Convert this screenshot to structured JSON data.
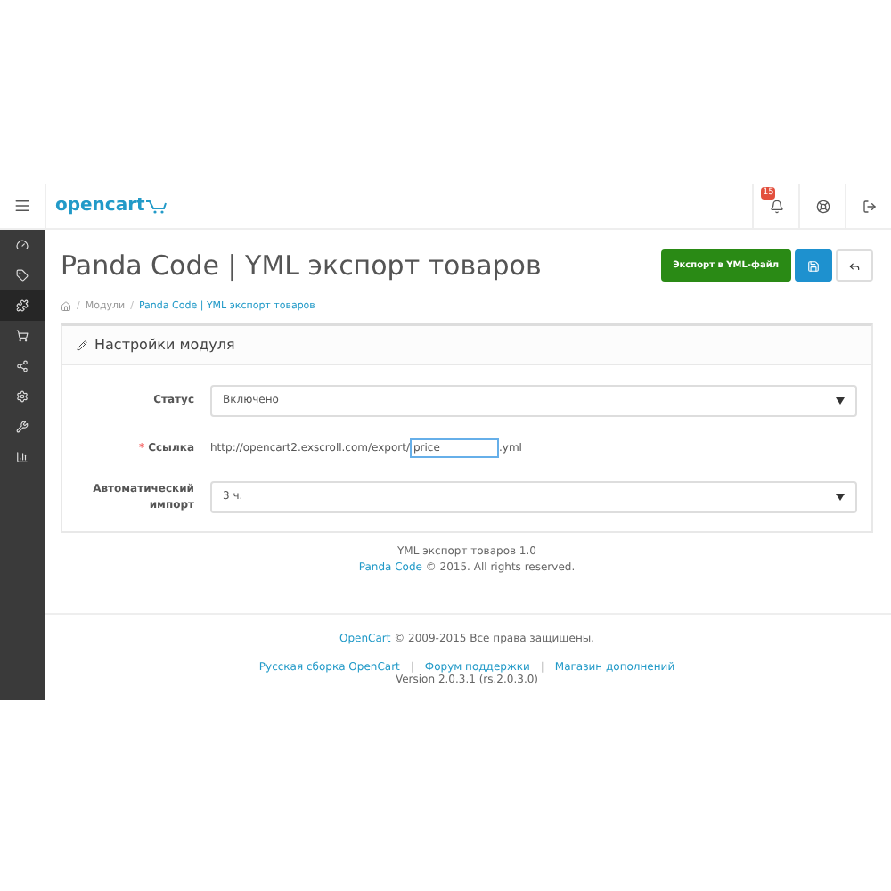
{
  "header": {
    "logo": "opencart",
    "notification_count": "15"
  },
  "sidebar": {
    "items": [
      {
        "kind": "dashboard",
        "selected": false
      },
      {
        "kind": "catalog",
        "selected": false
      },
      {
        "kind": "extensions",
        "selected": true
      },
      {
        "kind": "sales",
        "selected": false
      },
      {
        "kind": "marketing",
        "selected": false
      },
      {
        "kind": "system",
        "selected": false
      },
      {
        "kind": "tools",
        "selected": false
      },
      {
        "kind": "reports",
        "selected": false
      }
    ]
  },
  "page": {
    "title": "Panda Code | YML экспорт товаров",
    "buttons": [
      {
        "kind": "export",
        "label": "Экспорт в YML-файл"
      },
      {
        "kind": "save"
      },
      {
        "kind": "back"
      }
    ],
    "breadcrumb_separator": "/",
    "breadcrumbs": [
      "Модули",
      "Panda Code | YML экспорт товаров"
    ]
  },
  "panel": {
    "title": "Настройки модуля",
    "required_mark": "*",
    "fields": [
      {
        "kind": "select",
        "label": "Статус",
        "required": false,
        "value": "Включено"
      },
      {
        "kind": "link",
        "label": "Ссылка",
        "required": true,
        "prefix": "http://opencart2.exscroll.com/export/",
        "value": "price",
        "suffix": ".yml"
      },
      {
        "kind": "select",
        "label": "Автоматический импорт",
        "required": false,
        "value": "3 ч."
      }
    ]
  },
  "module_footer": {
    "title": "YML экспорт товаров 1.0",
    "link": "Panda Code",
    "text": "© 2015. All rights reserved."
  },
  "footer": {
    "link": "OpenCart",
    "text": "© 2009-2015 Все права защищены.",
    "separator": "|",
    "links": [
      "Русская сборка OpenCart",
      "Форум поддержки",
      "Магазин дополнений"
    ],
    "version": "Version 2.0.3.1 (rs.2.0.3.0)"
  }
}
